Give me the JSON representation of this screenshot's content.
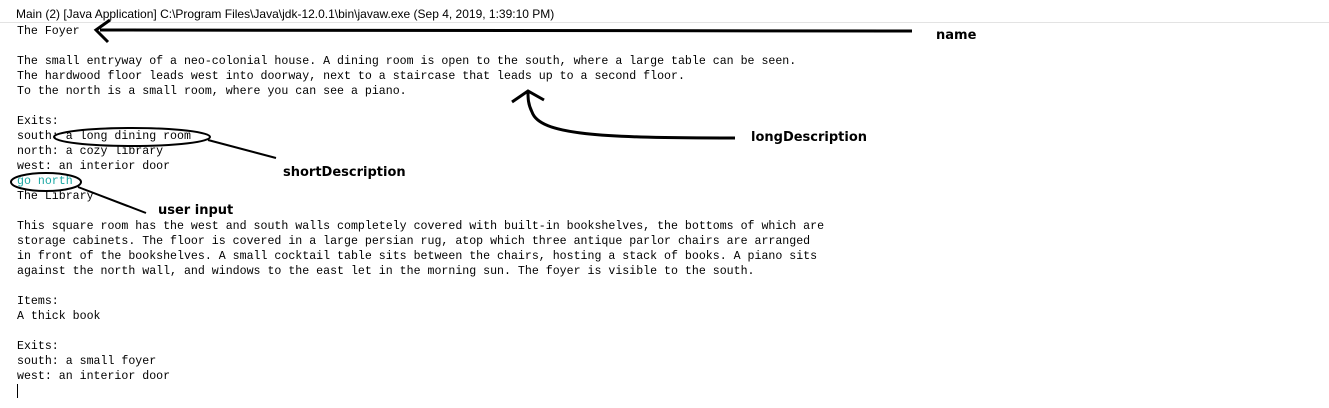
{
  "window": {
    "title": "Main (2) [Java Application] C:\\Program Files\\Java\\jdk-12.0.1\\bin\\javaw.exe (Sep 4, 2019, 1:39:10 PM)"
  },
  "console": {
    "lines": [
      {
        "text": "The Foyer"
      },
      {
        "text": ""
      },
      {
        "text": "The small entryway of a neo-colonial house. A dining room is open to the south, where a large table can be seen."
      },
      {
        "text": "The hardwood floor leads west into doorway, next to a staircase that leads up to a second floor."
      },
      {
        "text": "To the north is a small room, where you can see a piano."
      },
      {
        "text": ""
      },
      {
        "text": "Exits:"
      },
      {
        "text": "south: a long dining room"
      },
      {
        "text": "north: a cozy library"
      },
      {
        "text": "west: an interior door"
      },
      {
        "text": "go north",
        "is_input": true
      },
      {
        "text": "The Library"
      },
      {
        "text": ""
      },
      {
        "text": "This square room has the west and south walls completely covered with built-in bookshelves, the bottoms of which are"
      },
      {
        "text": "storage cabinets. The floor is covered in a large persian rug, atop which three antique parlor chairs are arranged"
      },
      {
        "text": "in front of the bookshelves. A small cocktail table sits between the chairs, hosting a stack of books. A piano sits"
      },
      {
        "text": "against the north wall, and windows to the east let in the morning sun. The foyer is visible to the south."
      },
      {
        "text": ""
      },
      {
        "text": "Items:"
      },
      {
        "text": "A thick book"
      },
      {
        "text": ""
      },
      {
        "text": "Exits:"
      },
      {
        "text": "south: a small foyer"
      },
      {
        "text": "west: an interior door"
      }
    ],
    "input_color": "#1aa7a3"
  },
  "annotations": {
    "name": "name",
    "long_description": "longDescription",
    "short_description": "shortDescription",
    "user_input": "user input"
  }
}
